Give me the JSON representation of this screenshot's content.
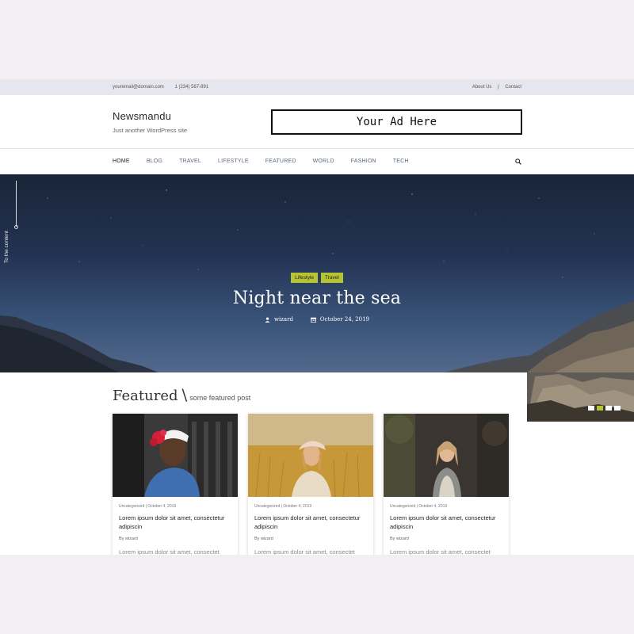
{
  "topbar": {
    "email": "youremail@domain.com",
    "phone": "1 (234) 567-891",
    "links": [
      "About Us",
      "Contact"
    ],
    "separator": "|"
  },
  "header": {
    "site_title": "Newsmandu",
    "tagline": "Just another WordPress site",
    "ad_text": "Your Ad Here"
  },
  "nav": {
    "items": [
      "HOME",
      "BLOG",
      "TRAVEL",
      "LIFESTYLE",
      "FEATURED",
      "WORLD",
      "FASHION",
      "TECH"
    ],
    "active_index": 0,
    "search_icon": "search-icon"
  },
  "hero": {
    "side_label": "To the content",
    "tags": [
      "Lifestyle",
      "Travel"
    ],
    "title": "Night near the sea",
    "author": "wizard",
    "date": "October 24, 2019",
    "slider_dots": 4,
    "active_dot": 1
  },
  "featured": {
    "heading": "Featured",
    "separator": "\\",
    "subheading": "some featured post",
    "cards": [
      {
        "meta": "Uncategorized | October 4, 2019",
        "title": "Lorem ipsum dolor sit amet, consectetur adipiscin",
        "by": "By wizard",
        "excerpt": "Lorem ipsum dolor sit amet, consectet"
      },
      {
        "meta": "Uncategorized | October 4, 2019",
        "title": "Lorem ipsum dolor sit amet, consectetur adipiscin",
        "by": "By wizard",
        "excerpt": "Lorem ipsum dolor sit amet, consectet"
      },
      {
        "meta": "Uncategorized | October 4, 2019",
        "title": "Lorem ipsum dolor sit amet, consectetur adipiscin",
        "by": "By wizard",
        "excerpt": "Lorem ipsum dolor sit amet, consectet"
      }
    ]
  },
  "colors": {
    "accent": "#b6c431",
    "nav_text": "#5c6a86",
    "topbar_bg": "#e6e6ee"
  }
}
